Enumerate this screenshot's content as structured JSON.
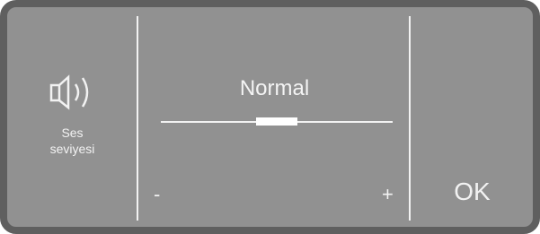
{
  "setting": {
    "icon": "speaker-icon",
    "label_line1": "Ses",
    "label_line2": "seviyesi"
  },
  "volume": {
    "level_label": "Normal",
    "level_fraction": 0.5,
    "minus_label": "-",
    "plus_label": "+"
  },
  "confirm": {
    "ok_label": "OK"
  },
  "colors": {
    "panel_background": "#919191",
    "frame": "#5f5f5f",
    "foreground": "#f2f2f2"
  }
}
